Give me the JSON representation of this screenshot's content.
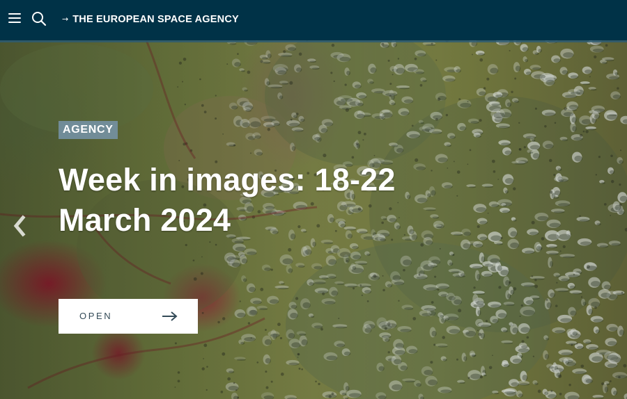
{
  "header": {
    "brand_arrow": "→",
    "brand_label": "THE EUROPEAN SPACE AGENCY",
    "background_color": "#003247",
    "icons": [
      "menu-icon",
      "search-icon"
    ]
  },
  "hero": {
    "category": "AGENCY",
    "title": "Week in images: 18-22 March 2024",
    "button_label": "OPEN",
    "icons": [
      "chevron-left-icon",
      "arrow-right-icon"
    ]
  },
  "colors": {
    "header_bg": "#003247",
    "badge_bg": "#7896af",
    "button_text": "#334a57",
    "hero_text": "#ffffff"
  }
}
